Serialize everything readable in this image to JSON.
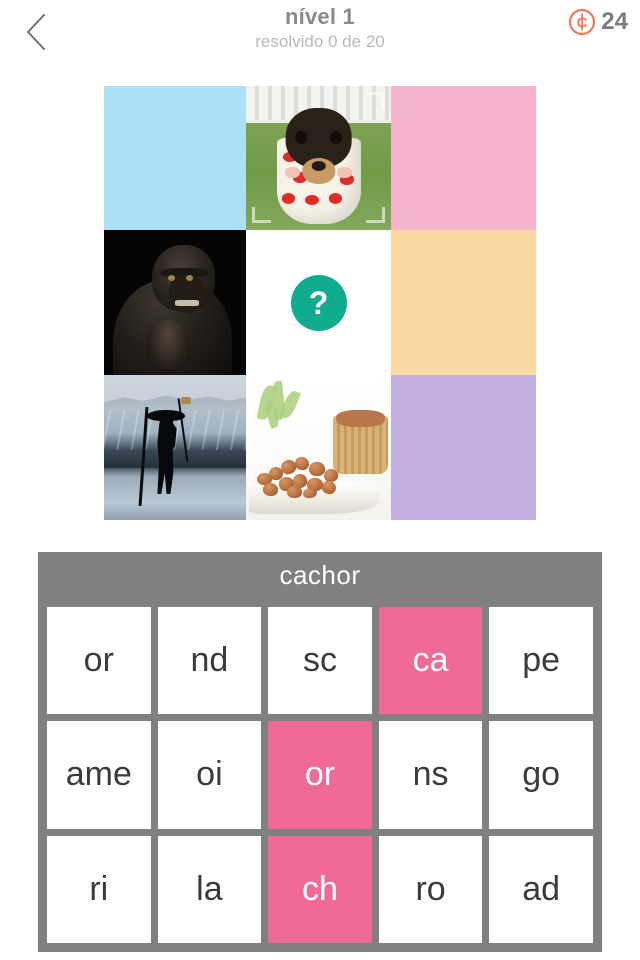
{
  "header": {
    "back_icon": "chevron-left-icon",
    "title": "nível 1",
    "subtitle": "resolvido 0 de 20",
    "coin_icon": "coin-icon",
    "coin_count": "24",
    "title_color": "#8a8a8a",
    "subtitle_color": "#b9b9b9",
    "coin_color": "#f4795b"
  },
  "puzzle": {
    "rows": 3,
    "cols": 3,
    "cells": [
      {
        "type": "placeholder",
        "name": "cell-1-1",
        "color": "#ace0f7",
        "label": ""
      },
      {
        "type": "image",
        "name": "cell-1-2",
        "subject": "puppy-in-polka-dot-cup"
      },
      {
        "type": "placeholder",
        "name": "cell-1-3",
        "color": "#f6b3cd",
        "label": ""
      },
      {
        "type": "image",
        "name": "cell-2-1",
        "subject": "gorilla-on-black"
      },
      {
        "type": "question",
        "name": "cell-2-2",
        "glyph": "?",
        "color": "#11ac8e"
      },
      {
        "type": "placeholder",
        "name": "cell-2-3",
        "color": "#fcd9a1",
        "label": ""
      },
      {
        "type": "image",
        "name": "cell-3-1",
        "subject": "fisherman-in-sea"
      },
      {
        "type": "image",
        "name": "cell-3-2",
        "subject": "peanuts-on-dish"
      },
      {
        "type": "placeholder",
        "name": "cell-3-3",
        "color": "#c3b0e0",
        "label": ""
      }
    ]
  },
  "word": {
    "current": "cachor",
    "panel_color": "#808080",
    "text_color": "#ffffff"
  },
  "tiles": {
    "selected_color": "#ef6a95",
    "default_color": "#ffffff",
    "text_color": "#3b3b3b",
    "rows": [
      [
        {
          "label": "or",
          "selected": false
        },
        {
          "label": "nd",
          "selected": false
        },
        {
          "label": "sc",
          "selected": false
        },
        {
          "label": "ca",
          "selected": true
        },
        {
          "label": "pe",
          "selected": false
        }
      ],
      [
        {
          "label": "ame",
          "selected": false
        },
        {
          "label": "oi",
          "selected": false
        },
        {
          "label": "or",
          "selected": true
        },
        {
          "label": "ns",
          "selected": false
        },
        {
          "label": "go",
          "selected": false
        }
      ],
      [
        {
          "label": "ri",
          "selected": false
        },
        {
          "label": "la",
          "selected": false
        },
        {
          "label": "ch",
          "selected": true
        },
        {
          "label": "ro",
          "selected": false
        },
        {
          "label": "ad",
          "selected": false
        }
      ]
    ]
  }
}
